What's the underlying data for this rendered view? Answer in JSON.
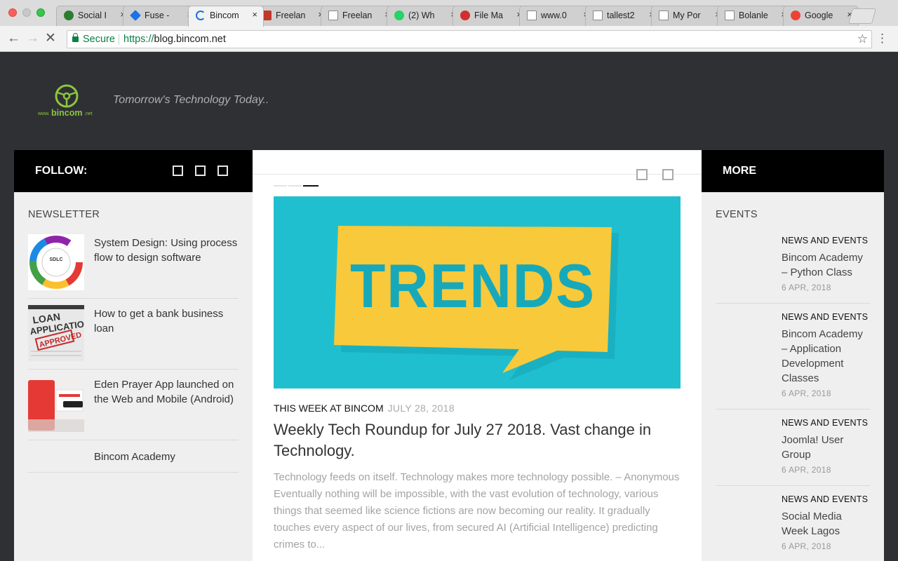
{
  "browser": {
    "tabs": [
      {
        "title": "Social I",
        "favicon_color": "#2e7d32"
      },
      {
        "title": "Fuse -",
        "favicon_color": "#1a73e8"
      },
      {
        "title": "Bincom",
        "favicon_color": "#1a73e8",
        "active": true
      },
      {
        "title": "Freelan",
        "favicon_color": "#c0392b"
      },
      {
        "title": "Freelan",
        "favicon_color": "#888888"
      },
      {
        "title": "(2) Wh",
        "favicon_color": "#25d366"
      },
      {
        "title": "File Ma",
        "favicon_color": "#d32f2f"
      },
      {
        "title": "www.0",
        "favicon_color": "#888888"
      },
      {
        "title": "tallest2",
        "favicon_color": "#888888"
      },
      {
        "title": "My Por",
        "favicon_color": "#888888"
      },
      {
        "title": "Bolanle",
        "favicon_color": "#888888"
      },
      {
        "title": "Google",
        "favicon_color": "#ea4335"
      }
    ],
    "tab_close_glyph": "×",
    "address": {
      "secure_label": "Secure",
      "scheme": "https://",
      "host": "blog.bincom.net"
    }
  },
  "site": {
    "logo_text": "bincom",
    "logo_prefix": "www.",
    "logo_suffix": ".net",
    "tagline": "Tomorrow's Technology Today..",
    "accent": "#8cc63f"
  },
  "follow": {
    "label": "FOLLOW:"
  },
  "more": {
    "label": "MORE"
  },
  "newsletter": {
    "title": "NEWSLETTER",
    "items": [
      {
        "title": "System Design: Using process flow to design software",
        "thumb": "sdlc-diagram"
      },
      {
        "title": "How to get a bank business loan",
        "thumb": "loan-application"
      },
      {
        "title": "Eden Prayer App launched on the Web and Mobile (Android)",
        "thumb": "prayer-app"
      },
      {
        "title": "Bincom Academy",
        "thumb": ""
      }
    ],
    "sdlc_label": "SDLC"
  },
  "featured": {
    "hero_text": "TRENDS",
    "hero_bg": "#20bfd0",
    "hero_card": "#f8c93a",
    "category": "THIS WEEK AT BINCOM",
    "date": "JULY 28, 2018",
    "title": "Weekly Tech Roundup for July 27 2018. Vast change in Technology.",
    "excerpt": "Technology feeds on itself. Technology makes more technology possible. – Anonymous Eventually nothing will be impossible, with the vast evolution of technology, various things that seemed like science fictions are now becoming our reality. It gradually touches every aspect of our lives, from secured AI (Artificial Intelligence) predicting crimes to..."
  },
  "events": {
    "title": "EVENTS",
    "items": [
      {
        "category": "NEWS AND EVENTS",
        "title": "Bincom Academy – Python Class",
        "date": "6 APR, 2018"
      },
      {
        "category": "NEWS AND EVENTS",
        "title": "Bincom Academy – Application Development Classes",
        "date": "6 APR, 2018"
      },
      {
        "category": "NEWS AND EVENTS",
        "title": "Joomla! User Group",
        "date": "6 APR, 2018"
      },
      {
        "category": "NEWS AND EVENTS",
        "title": "Social Media Week Lagos",
        "date": "6 APR, 2018"
      }
    ]
  }
}
